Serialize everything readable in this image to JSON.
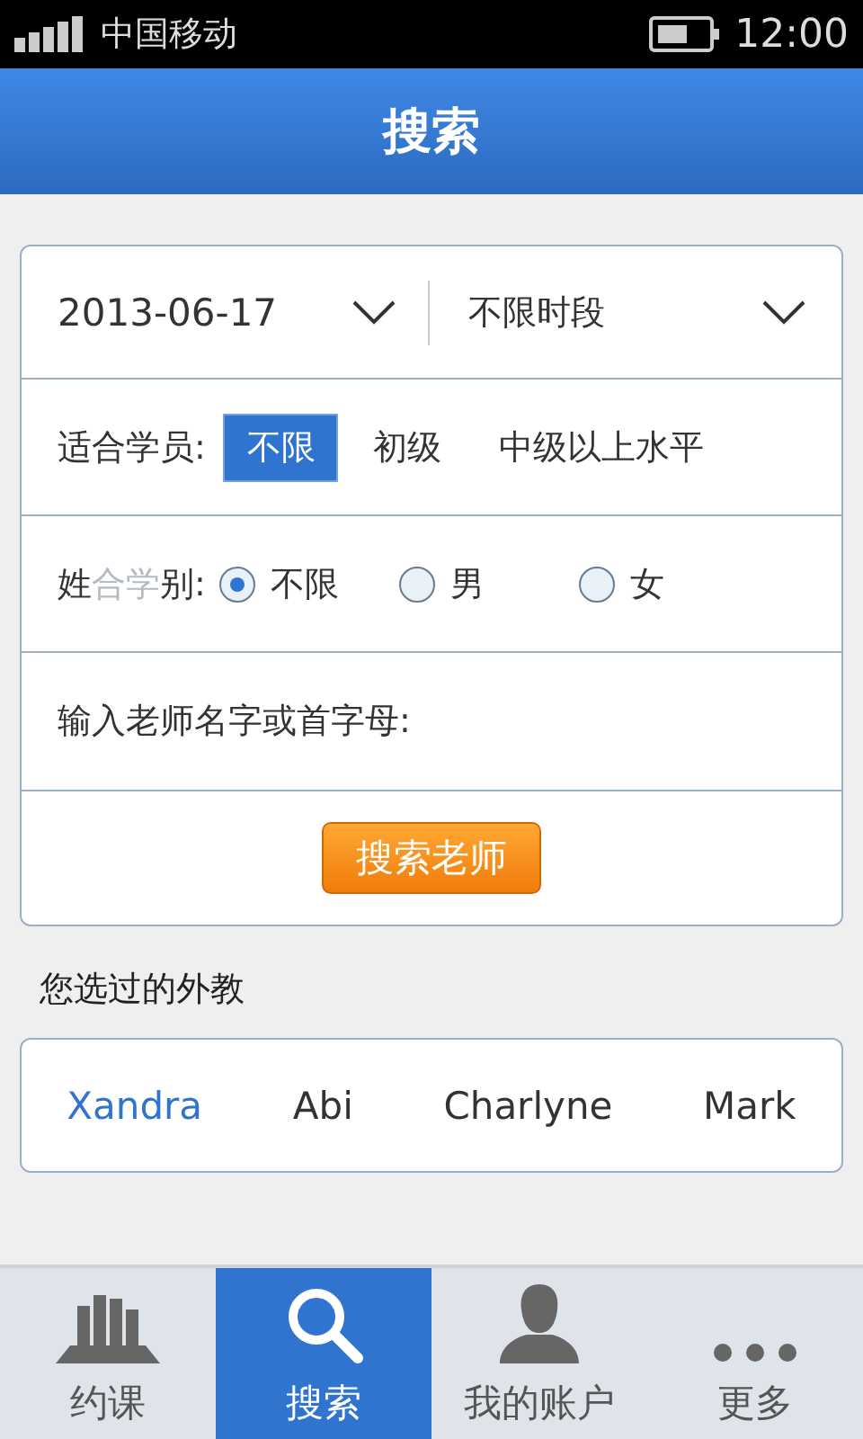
{
  "status_bar": {
    "carrier": "中国移动",
    "time": "12:00"
  },
  "header": {
    "title": "搜索"
  },
  "filters": {
    "date": "2013-06-17",
    "period": "不限时段",
    "level": {
      "label": "适合学员:",
      "options": [
        {
          "label": "不限",
          "selected": true
        },
        {
          "label": "初级",
          "selected": false
        },
        {
          "label": "中级以上水平",
          "selected": false
        }
      ]
    },
    "gender": {
      "label_parts": [
        {
          "text": "姓",
          "faint": false
        },
        {
          "text": "合学",
          "faint": true
        },
        {
          "text": "别:",
          "faint": false
        }
      ],
      "options": [
        {
          "label": "不限",
          "selected": true
        },
        {
          "label": "男",
          "selected": false
        },
        {
          "label": "女",
          "selected": false
        }
      ]
    },
    "name_label": "输入老师名字或首字母:",
    "search_button": "搜索老师"
  },
  "history": {
    "title": "您选过的外教",
    "teachers": [
      {
        "name": "Xandra",
        "selected": true
      },
      {
        "name": "Abi",
        "selected": false
      },
      {
        "name": "Charlyne",
        "selected": false
      },
      {
        "name": "Mark",
        "selected": false
      }
    ]
  },
  "tab_bar": [
    {
      "kind": "books",
      "label": "约课",
      "selected": false
    },
    {
      "kind": "search",
      "label": "搜索",
      "selected": true
    },
    {
      "kind": "person",
      "label": "我的账户",
      "selected": false
    },
    {
      "kind": "more",
      "label": "更多",
      "selected": false
    }
  ]
}
